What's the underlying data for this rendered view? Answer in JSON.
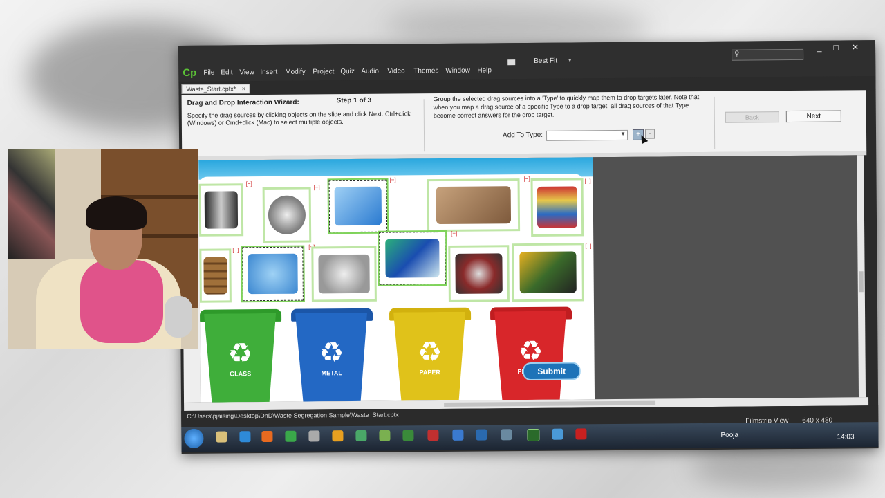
{
  "app": {
    "logo": "Cp",
    "menu": [
      "File",
      "Edit",
      "View",
      "Insert",
      "Modify",
      "Project",
      "Quiz",
      "Audio",
      "Video",
      "Themes",
      "Window",
      "Help"
    ],
    "zoom": "Best Fit",
    "window_controls": [
      "_",
      "□",
      "✕"
    ]
  },
  "document_tab": {
    "label": "Waste_Start.cptx*",
    "close": "×"
  },
  "wizard": {
    "title": "Drag and Drop Interaction Wizard:",
    "step": "Step 1 of 3",
    "description": "Specify the drag sources by clicking objects on the slide and click Next. Ctrl+click (Windows) or Cmd+click (Mac) to select multiple objects.",
    "help": "Group the selected drag sources into a 'Type' to quickly map them to drop targets later. Note that when you map a drag source of a specific Type to a drop target, all drag sources of that Type become correct answers for the drop target.",
    "add_to_type_label": "Add To Type:",
    "add_to_type_value": "",
    "plus_label": "+",
    "minus_label": "-",
    "back_label": "Back",
    "next_label": "Next"
  },
  "slide": {
    "item_tag": "[−]",
    "bins": [
      {
        "label": "GLASS",
        "color": "#3fae3a",
        "lid": "#2e9a2a"
      },
      {
        "label": "METAL",
        "color": "#2368c4",
        "lid": "#1b56a8"
      },
      {
        "label": "PAPER",
        "color": "#e0c21a",
        "lid": "#d2b10e"
      },
      {
        "label": "PLASTIC",
        "color": "#d8262a",
        "lid": "#c01d20"
      }
    ],
    "recycle_symbol": "♻",
    "submit_label": "Submit"
  },
  "status": {
    "path": "C:\\Users\\pjaising\\Desktop\\DnD\\Waste Segregation Sample\\Waste_Start.cptx",
    "filmstrip": "Filmstrip View",
    "stage_size": "640 x 480"
  },
  "taskbar": {
    "user": "Pooja",
    "time": "14:03"
  },
  "colors": {
    "accent": "#5bc236",
    "slide_band": "#2aa7de",
    "item_border": "#bfe6a6"
  }
}
